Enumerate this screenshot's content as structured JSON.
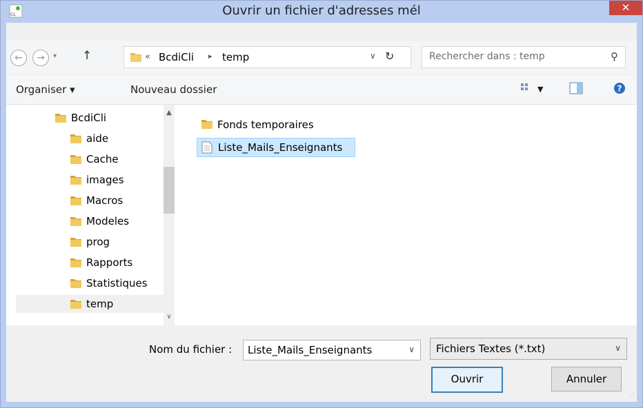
{
  "window": {
    "title": "Ouvrir un fichier d'adresses mél",
    "close_label": "✕"
  },
  "nav": {
    "back_icon": "back-arrow-icon",
    "forward_icon": "forward-arrow-icon",
    "up_icon": "up-arrow-icon",
    "breadcrumb": [
      "BcdiCli",
      "temp"
    ],
    "overflow_marker": "«"
  },
  "search": {
    "placeholder": "Rechercher dans : temp"
  },
  "toolbar": {
    "organise": "Organiser ▾",
    "new_folder": "Nouveau dossier"
  },
  "tree": [
    {
      "label": "BcdiCli",
      "indent": 1
    },
    {
      "label": "aide",
      "indent": 2
    },
    {
      "label": "Cache",
      "indent": 2
    },
    {
      "label": "images",
      "indent": 2
    },
    {
      "label": "Macros",
      "indent": 2
    },
    {
      "label": "Modeles",
      "indent": 2
    },
    {
      "label": "prog",
      "indent": 2
    },
    {
      "label": "Rapports",
      "indent": 2
    },
    {
      "label": "Statistiques",
      "indent": 2
    },
    {
      "label": "temp",
      "indent": 2,
      "selected": true
    }
  ],
  "files": [
    {
      "label": "Fonds temporaires",
      "type": "folder"
    },
    {
      "label": "Liste_Mails_Enseignants",
      "type": "text",
      "selected": true
    }
  ],
  "footer": {
    "filename_label": "Nom du fichier :",
    "filename_value": "Liste_Mails_Enseignants",
    "filter_value": "Fichiers Textes (*.txt)",
    "open_button": "Ouvrir",
    "cancel_button": "Annuler"
  },
  "colors": {
    "titlebar": "#b9cdf0",
    "close": "#c9463d",
    "selection": "#cce8ff",
    "folder": "#e8b84a"
  }
}
